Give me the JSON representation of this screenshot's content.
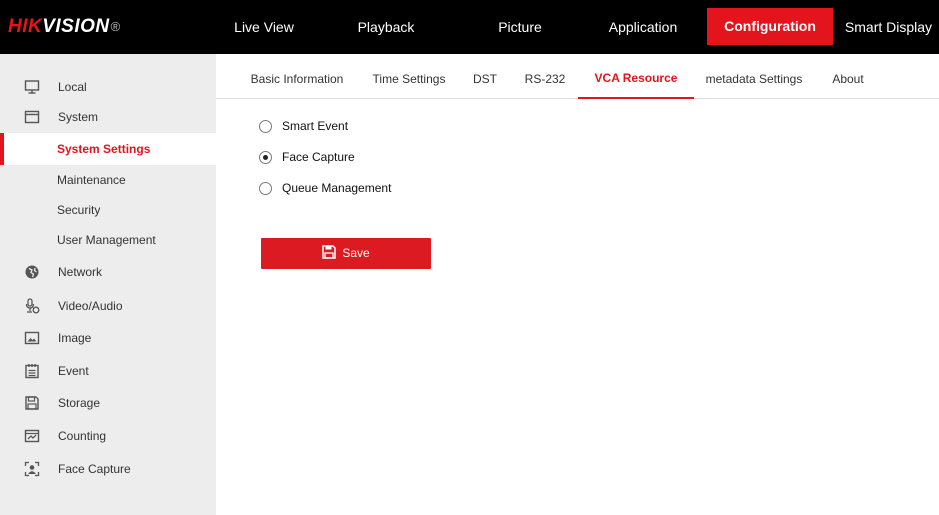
{
  "logo": {
    "brand_red": "HIK",
    "brand_white": "VISION",
    "registered": "®"
  },
  "topnav": [
    {
      "label": "Live View"
    },
    {
      "label": "Playback"
    },
    {
      "label": "Picture"
    },
    {
      "label": "Application"
    },
    {
      "label": "Configuration",
      "active": true
    },
    {
      "label": "Smart Display"
    }
  ],
  "sidebar": {
    "items": [
      {
        "label": "Local",
        "icon": "monitor-icon"
      },
      {
        "label": "System",
        "icon": "window-icon"
      },
      {
        "label": "System Settings",
        "active": true
      },
      {
        "label": "Maintenance"
      },
      {
        "label": "Security"
      },
      {
        "label": "User Management"
      },
      {
        "label": "Network",
        "icon": "globe-icon"
      },
      {
        "label": "Video/Audio",
        "icon": "microphone-icon"
      },
      {
        "label": "Image",
        "icon": "image-icon"
      },
      {
        "label": "Event",
        "icon": "calendar-icon"
      },
      {
        "label": "Storage",
        "icon": "floppy-icon"
      },
      {
        "label": "Counting",
        "icon": "counting-icon"
      },
      {
        "label": "Face Capture",
        "icon": "face-capture-icon"
      }
    ]
  },
  "tabs": [
    {
      "label": "Basic Information"
    },
    {
      "label": "Time Settings"
    },
    {
      "label": "DST"
    },
    {
      "label": "RS-232"
    },
    {
      "label": "VCA Resource",
      "active": true
    },
    {
      "label": "metadata Settings"
    },
    {
      "label": "About"
    }
  ],
  "vca_options": [
    {
      "label": "Smart Event",
      "checked": false
    },
    {
      "label": "Face Capture",
      "checked": true
    },
    {
      "label": "Queue Management",
      "checked": false
    }
  ],
  "save_label": "Save",
  "colors": {
    "accent": "#e3141c",
    "topbar": "#000000",
    "sidebar": "#ededed"
  }
}
